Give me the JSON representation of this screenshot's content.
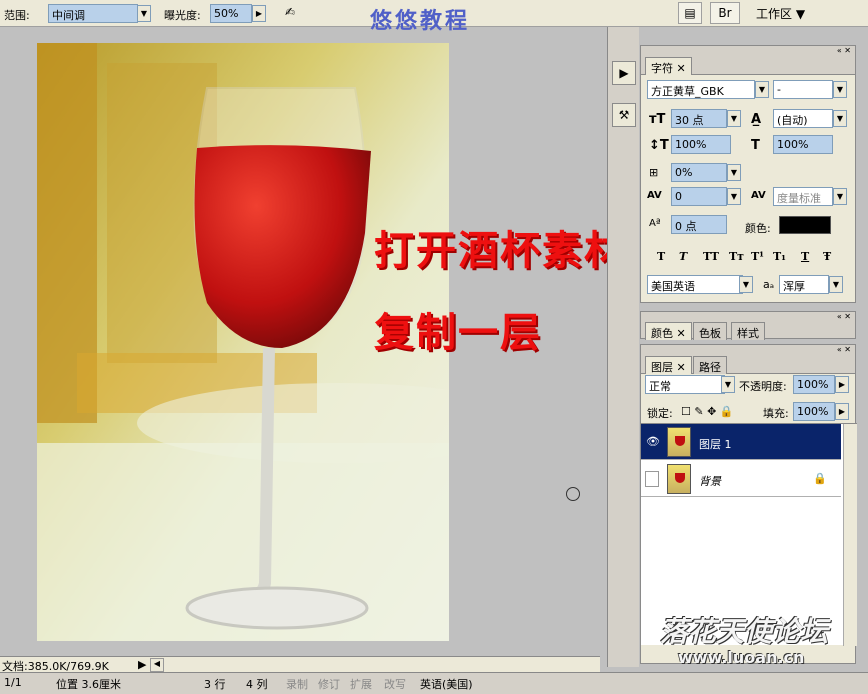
{
  "options_bar": {
    "range_label": "范围:",
    "range_value": "中间调",
    "exposure_label": "曝光度:",
    "exposure_value": "50%",
    "title_cn": "悠悠教程",
    "workspace_label": "工作区"
  },
  "canvas": {
    "line1": "打开酒杯素材",
    "line2": "复制一层"
  },
  "character_panel": {
    "tab": "字符",
    "font_family": "方正黄草_GBK",
    "font_style": "-",
    "font_size": "30 点",
    "leading": "(自动)",
    "vert_scale": "100%",
    "horiz_scale": "100%",
    "tracking_sub": "0%",
    "kerning": "0",
    "kerning_metric": "度量标准",
    "baseline": "0 点",
    "color_label": "颜色:",
    "style_buttons": [
      "T",
      "T",
      "TT",
      "Tт",
      "T¹",
      "T₁",
      "T",
      "Ŧ"
    ],
    "language": "美国英语",
    "aa_label": "aₐ",
    "aa_value": "浑厚",
    "color_value": "#000000"
  },
  "color_panel": {
    "tabs": [
      "颜色",
      "色板",
      "样式"
    ]
  },
  "layers_panel": {
    "tabs": [
      "图层",
      "路径"
    ],
    "blend_mode": "正常",
    "opacity_label": "不透明度:",
    "opacity_value": "100%",
    "lock_label": "锁定:",
    "fill_label": "填充:",
    "fill_value": "100%",
    "layers": [
      {
        "name": "图层 1",
        "selected": true
      },
      {
        "name": "背景",
        "selected": false
      }
    ],
    "selected_color": "#0a246a"
  },
  "status": {
    "doc": "文档:385.0K/769.9K"
  },
  "bottom": {
    "page": "1/1",
    "pos": "位置 3.6厘米",
    "row": "3 行",
    "col": "4 列",
    "rec": "录制",
    "rev": "修订",
    "ext": "扩展",
    "ovr": "改写",
    "lang": "英语(美国)"
  },
  "watermark": {
    "text": "落花天使论坛",
    "url": "www.luoan.cn"
  }
}
